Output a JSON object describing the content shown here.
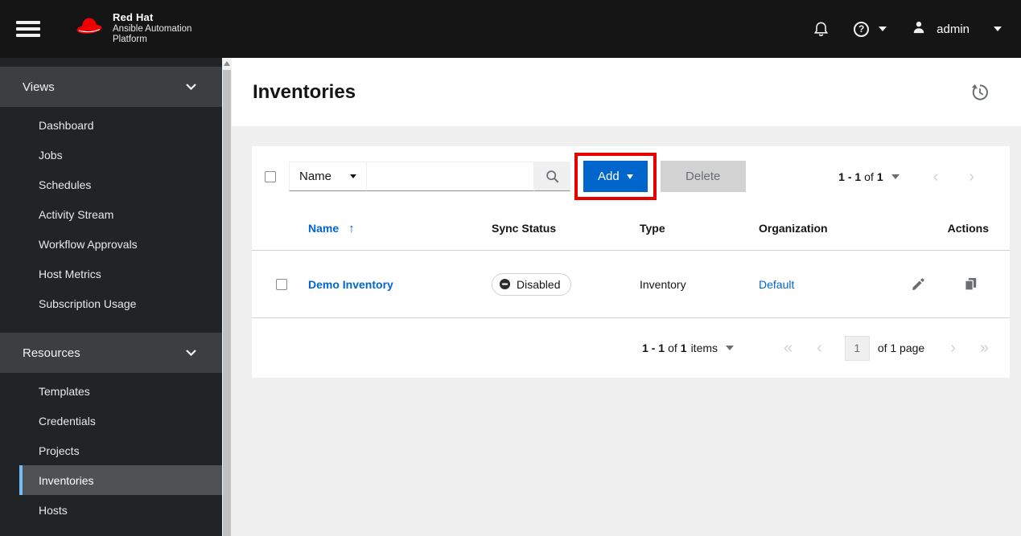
{
  "masthead": {
    "brand_name": "Red Hat",
    "brand_line1": "Ansible Automation",
    "brand_line2": "Platform",
    "help_glyph": "?",
    "user": "admin"
  },
  "sidebar": {
    "sections": [
      {
        "label": "Views",
        "items": [
          "Dashboard",
          "Jobs",
          "Schedules",
          "Activity Stream",
          "Workflow Approvals",
          "Host Metrics",
          "Subscription Usage"
        ]
      },
      {
        "label": "Resources",
        "items": [
          "Templates",
          "Credentials",
          "Projects",
          "Inventories",
          "Hosts"
        ]
      }
    ],
    "selected_item": "Inventories"
  },
  "page": {
    "title": "Inventories"
  },
  "toolbar": {
    "filter_selected": "Name",
    "search_value": "",
    "add_label": "Add",
    "delete_label": "Delete",
    "pagination": {
      "range": "1 - 1",
      "of": "of",
      "total": "1"
    }
  },
  "table": {
    "columns": {
      "name": "Name",
      "sync_status": "Sync Status",
      "type": "Type",
      "organization": "Organization",
      "actions": "Actions"
    },
    "sort": {
      "column": "Name",
      "direction": "ascending",
      "arrow": "↑"
    },
    "rows": [
      {
        "name": "Demo Inventory",
        "sync_status": "Disabled",
        "type": "Inventory",
        "organization": "Default"
      }
    ]
  },
  "footer_pagination": {
    "range": "1 - 1",
    "of": "of",
    "total": "1",
    "items_word": "items",
    "current_page": "1",
    "page_of": "of 1 page",
    "first": "«",
    "prev": "‹",
    "next": "›",
    "last": "»"
  },
  "colors": {
    "masthead_bg": "#151515",
    "sidebar_bg": "#212427",
    "sidebar_section_bg": "#3c3f42",
    "selected_nav_bg": "#4f5255",
    "selected_nav_accent": "#73bcf7",
    "primary_blue": "#0066cc",
    "link_blue": "#0066cc",
    "annotation_red": "#e60000",
    "brand_red": "#ee0000",
    "disabled_gray": "#d2d2d2",
    "icon_gray": "#6a6e73",
    "page_bg": "#f0f0f0"
  }
}
